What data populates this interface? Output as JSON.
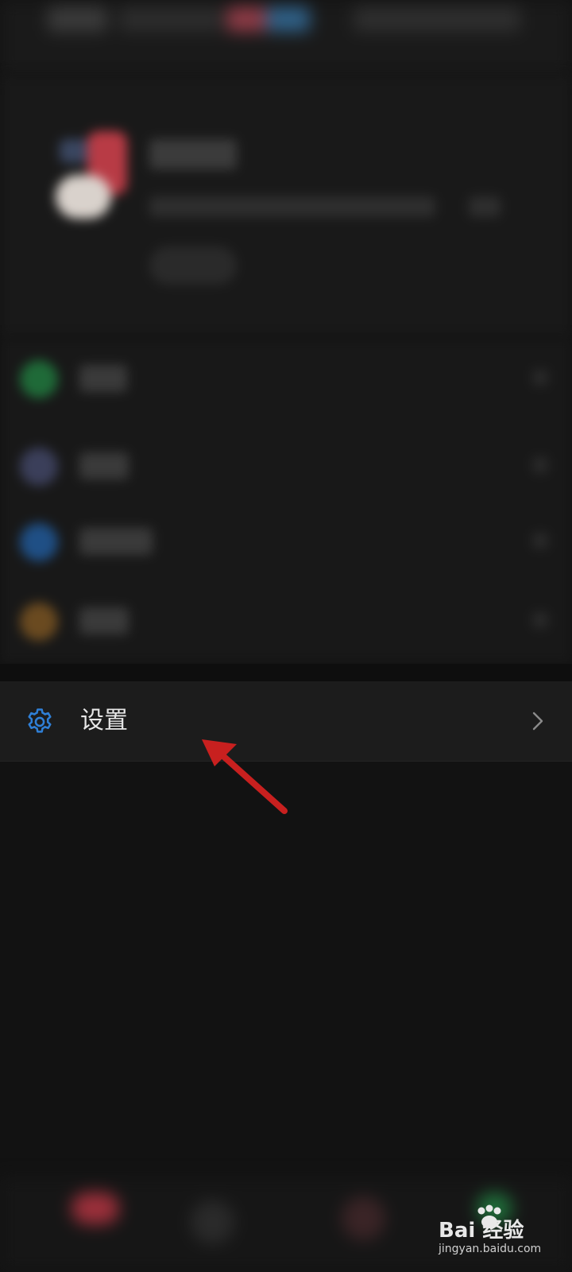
{
  "settings_row": {
    "label": "设置",
    "icon": "gear-icon",
    "icon_color": "#2f7fd6",
    "chevron": "chevron-right-icon"
  },
  "annotation": {
    "color": "#c8201f"
  },
  "watermark": {
    "brand": "Bai 经验",
    "url": "jingyan.baidu.com"
  }
}
